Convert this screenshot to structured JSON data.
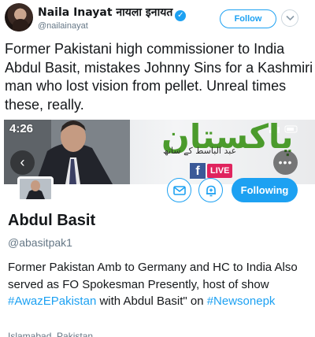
{
  "tweet": {
    "display_name": "Naila Inayat नायला इनायत",
    "handle": "@nailainayat",
    "follow_label": "Follow",
    "text": "Former Pakistani high commissioner to India Abdul Basit, mistakes Johnny Sins for a Kashmiri man who lost vision from pellet. Unreal times these, really."
  },
  "embed": {
    "status_time": "4:26",
    "banner_brand": "پاکستان",
    "banner_subtitle": "عبد الباسط کے ساتھ",
    "fb_letter": "f",
    "live_label": "LIVE",
    "back_symbol": "‹",
    "more_symbol": "•••",
    "following_label": "Following",
    "profile_name": "Abdul Basit",
    "profile_handle": "@abasitpak1",
    "bio_text": "Former Pakistan Amb to Germany and HC to India Also served as FO Spokesman Presently, host of show ",
    "bio_hashtag_1": "#AwazEPakistan",
    "bio_text_2": " with Abdul Basit\" on ",
    "bio_hashtag_2": "#Newsonepk",
    "cut_row_text": "Islamabad, Pakistan"
  },
  "colors": {
    "accent": "#1da1f2",
    "live": "#e0245e",
    "facebook": "#3b5998",
    "brand_green": "#4b9b2c"
  },
  "icons": [
    "verified-icon",
    "chevron-down-icon",
    "back-icon",
    "more-icon",
    "mail-icon",
    "bell-plus-icon",
    "facebook-icon"
  ]
}
